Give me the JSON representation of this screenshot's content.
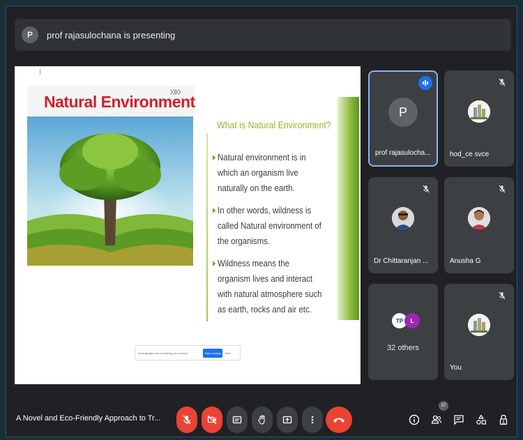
{
  "presenting_bar": {
    "avatar_letter": "P",
    "text": "prof rajasulochana is presenting"
  },
  "slide": {
    "title": "Natural Environment",
    "chevrons": "»»",
    "subtitle": "What is Natural Environment?",
    "bullets": [
      "Natural environment is in which an organism live naturally on the earth.",
      "In other words, wildness is called Natural environment of the organisms.",
      "Wildness means the organism lives and interact with natural atmosphere such as earth, rocks and air etc."
    ],
    "share_bar": {
      "text": "meet.google.com is sharing your screen",
      "stop_label": "Stop sharing",
      "hide_label": "Hide"
    }
  },
  "participants": [
    {
      "name": "prof rajasulochana",
      "display_name": "prof rajasulocha...",
      "avatar_letter": "P",
      "speaking": true,
      "active": true
    },
    {
      "name": "hod_ce svce",
      "display_name": "hod_ce svce",
      "muted": true
    },
    {
      "name": "Dr Chittaranjan",
      "display_name": "Dr Chittaranjan ...",
      "muted": true
    },
    {
      "name": "Anusha G",
      "display_name": "Anusha G",
      "muted": true
    },
    {
      "name": "32 others",
      "display_name": "32 others",
      "avatar_letters": [
        "TP",
        "L"
      ]
    },
    {
      "name": "You",
      "display_name": "You",
      "muted": true
    }
  ],
  "controls": {
    "meeting_title": "A Novel and Eco-Friendly Approach to Tr...",
    "participant_count": "37"
  },
  "colors": {
    "accent_blue": "#1a73e8",
    "control_red": "#ea4335",
    "tile_bg": "#3c4043",
    "slide_title_red": "#d0202a",
    "slide_green": "#9bb02c"
  }
}
